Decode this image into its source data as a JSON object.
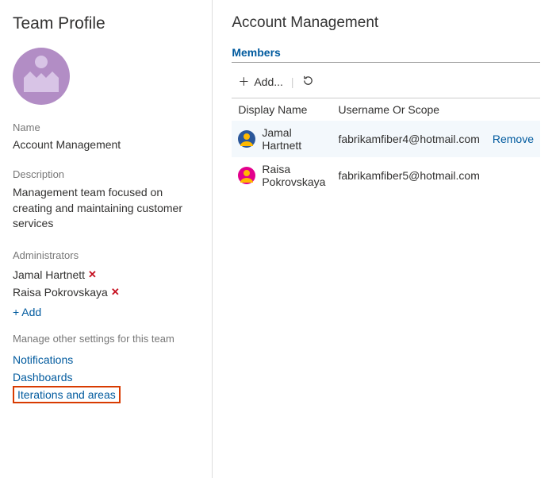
{
  "sidebar": {
    "title": "Team Profile",
    "name_label": "Name",
    "name_value": "Account Management",
    "description_label": "Description",
    "description_value": "Management team focused on creating and maintaining customer services",
    "admins_label": "Administrators",
    "admins": [
      {
        "name": "Jamal Hartnett"
      },
      {
        "name": "Raisa Pokrovskaya"
      }
    ],
    "add_label": "+ Add",
    "manage_label": "Manage other settings for this team",
    "links": {
      "notifications": "Notifications",
      "dashboards": "Dashboards",
      "iterations": "Iterations and areas"
    }
  },
  "main": {
    "title": "Account Management",
    "members_label": "Members",
    "add_button": "Add...",
    "columns": {
      "display_name": "Display Name",
      "username": "Username Or Scope"
    },
    "rows": [
      {
        "name": "Jamal Hartnett",
        "email": "fabrikamfiber4@hotmail.com",
        "avatar_bg": "#2b579a",
        "avatar_fg": "#ffb900"
      },
      {
        "name": "Raisa Pokrovskaya",
        "email": "fabrikamfiber5@hotmail.com",
        "avatar_bg": "#e3008c",
        "avatar_fg": "#ffb900"
      }
    ],
    "remove_label": "Remove"
  }
}
